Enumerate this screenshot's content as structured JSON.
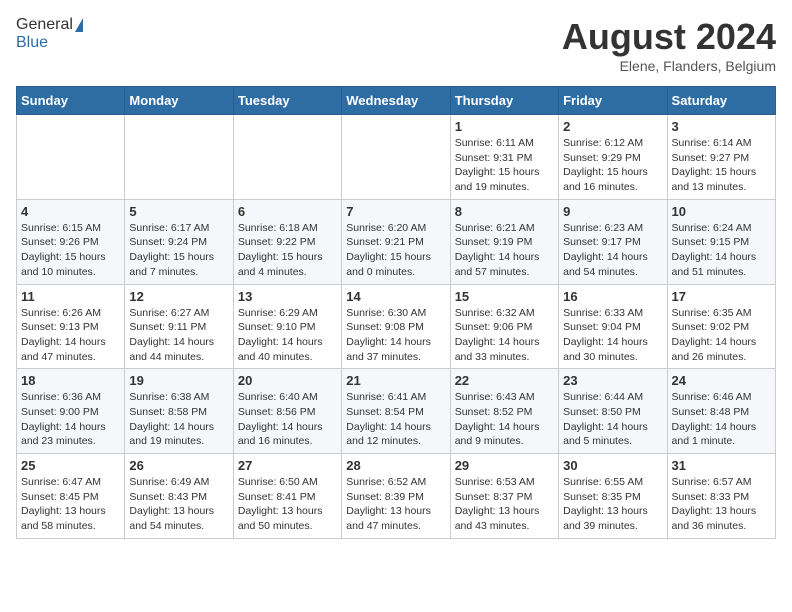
{
  "header": {
    "logo_general": "General",
    "logo_blue": "Blue",
    "month": "August 2024",
    "location": "Elene, Flanders, Belgium"
  },
  "weekdays": [
    "Sunday",
    "Monday",
    "Tuesday",
    "Wednesday",
    "Thursday",
    "Friday",
    "Saturday"
  ],
  "weeks": [
    [
      {
        "day": "",
        "content": ""
      },
      {
        "day": "",
        "content": ""
      },
      {
        "day": "",
        "content": ""
      },
      {
        "day": "",
        "content": ""
      },
      {
        "day": "1",
        "content": "Sunrise: 6:11 AM\nSunset: 9:31 PM\nDaylight: 15 hours\nand 19 minutes."
      },
      {
        "day": "2",
        "content": "Sunrise: 6:12 AM\nSunset: 9:29 PM\nDaylight: 15 hours\nand 16 minutes."
      },
      {
        "day": "3",
        "content": "Sunrise: 6:14 AM\nSunset: 9:27 PM\nDaylight: 15 hours\nand 13 minutes."
      }
    ],
    [
      {
        "day": "4",
        "content": "Sunrise: 6:15 AM\nSunset: 9:26 PM\nDaylight: 15 hours\nand 10 minutes."
      },
      {
        "day": "5",
        "content": "Sunrise: 6:17 AM\nSunset: 9:24 PM\nDaylight: 15 hours\nand 7 minutes."
      },
      {
        "day": "6",
        "content": "Sunrise: 6:18 AM\nSunset: 9:22 PM\nDaylight: 15 hours\nand 4 minutes."
      },
      {
        "day": "7",
        "content": "Sunrise: 6:20 AM\nSunset: 9:21 PM\nDaylight: 15 hours\nand 0 minutes."
      },
      {
        "day": "8",
        "content": "Sunrise: 6:21 AM\nSunset: 9:19 PM\nDaylight: 14 hours\nand 57 minutes."
      },
      {
        "day": "9",
        "content": "Sunrise: 6:23 AM\nSunset: 9:17 PM\nDaylight: 14 hours\nand 54 minutes."
      },
      {
        "day": "10",
        "content": "Sunrise: 6:24 AM\nSunset: 9:15 PM\nDaylight: 14 hours\nand 51 minutes."
      }
    ],
    [
      {
        "day": "11",
        "content": "Sunrise: 6:26 AM\nSunset: 9:13 PM\nDaylight: 14 hours\nand 47 minutes."
      },
      {
        "day": "12",
        "content": "Sunrise: 6:27 AM\nSunset: 9:11 PM\nDaylight: 14 hours\nand 44 minutes."
      },
      {
        "day": "13",
        "content": "Sunrise: 6:29 AM\nSunset: 9:10 PM\nDaylight: 14 hours\nand 40 minutes."
      },
      {
        "day": "14",
        "content": "Sunrise: 6:30 AM\nSunset: 9:08 PM\nDaylight: 14 hours\nand 37 minutes."
      },
      {
        "day": "15",
        "content": "Sunrise: 6:32 AM\nSunset: 9:06 PM\nDaylight: 14 hours\nand 33 minutes."
      },
      {
        "day": "16",
        "content": "Sunrise: 6:33 AM\nSunset: 9:04 PM\nDaylight: 14 hours\nand 30 minutes."
      },
      {
        "day": "17",
        "content": "Sunrise: 6:35 AM\nSunset: 9:02 PM\nDaylight: 14 hours\nand 26 minutes."
      }
    ],
    [
      {
        "day": "18",
        "content": "Sunrise: 6:36 AM\nSunset: 9:00 PM\nDaylight: 14 hours\nand 23 minutes."
      },
      {
        "day": "19",
        "content": "Sunrise: 6:38 AM\nSunset: 8:58 PM\nDaylight: 14 hours\nand 19 minutes."
      },
      {
        "day": "20",
        "content": "Sunrise: 6:40 AM\nSunset: 8:56 PM\nDaylight: 14 hours\nand 16 minutes."
      },
      {
        "day": "21",
        "content": "Sunrise: 6:41 AM\nSunset: 8:54 PM\nDaylight: 14 hours\nand 12 minutes."
      },
      {
        "day": "22",
        "content": "Sunrise: 6:43 AM\nSunset: 8:52 PM\nDaylight: 14 hours\nand 9 minutes."
      },
      {
        "day": "23",
        "content": "Sunrise: 6:44 AM\nSunset: 8:50 PM\nDaylight: 14 hours\nand 5 minutes."
      },
      {
        "day": "24",
        "content": "Sunrise: 6:46 AM\nSunset: 8:48 PM\nDaylight: 14 hours\nand 1 minute."
      }
    ],
    [
      {
        "day": "25",
        "content": "Sunrise: 6:47 AM\nSunset: 8:45 PM\nDaylight: 13 hours\nand 58 minutes."
      },
      {
        "day": "26",
        "content": "Sunrise: 6:49 AM\nSunset: 8:43 PM\nDaylight: 13 hours\nand 54 minutes."
      },
      {
        "day": "27",
        "content": "Sunrise: 6:50 AM\nSunset: 8:41 PM\nDaylight: 13 hours\nand 50 minutes."
      },
      {
        "day": "28",
        "content": "Sunrise: 6:52 AM\nSunset: 8:39 PM\nDaylight: 13 hours\nand 47 minutes."
      },
      {
        "day": "29",
        "content": "Sunrise: 6:53 AM\nSunset: 8:37 PM\nDaylight: 13 hours\nand 43 minutes."
      },
      {
        "day": "30",
        "content": "Sunrise: 6:55 AM\nSunset: 8:35 PM\nDaylight: 13 hours\nand 39 minutes."
      },
      {
        "day": "31",
        "content": "Sunrise: 6:57 AM\nSunset: 8:33 PM\nDaylight: 13 hours\nand 36 minutes."
      }
    ]
  ]
}
